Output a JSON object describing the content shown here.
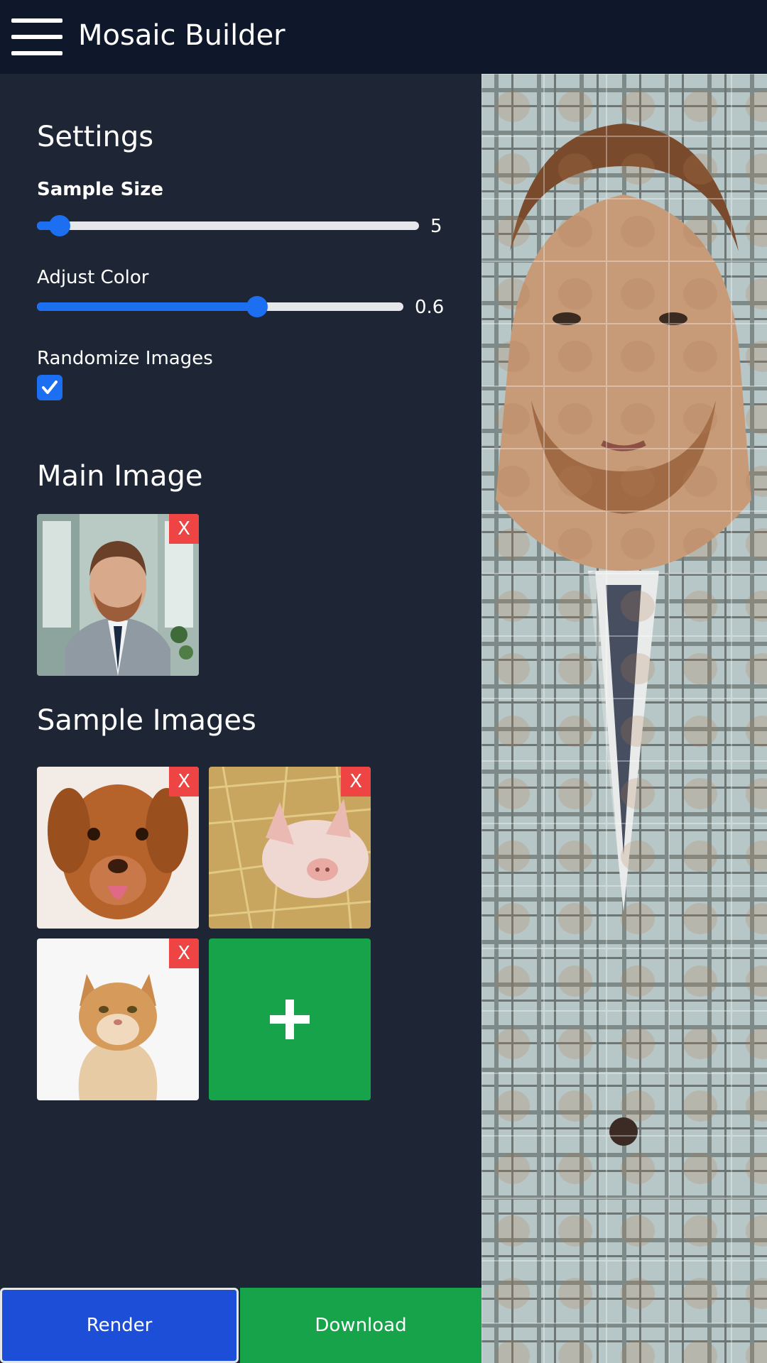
{
  "header": {
    "title": "Mosaic Builder",
    "menu_icon": "hamburger-menu-icon"
  },
  "settings": {
    "heading": "Settings",
    "sample_size": {
      "label": "Sample Size",
      "value": "5",
      "fraction": 0.06
    },
    "adjust_color": {
      "label": "Adjust Color",
      "value": "0.6",
      "fraction": 0.6
    },
    "randomize": {
      "label": "Randomize Images",
      "checked": true
    }
  },
  "main_image": {
    "heading": "Main Image",
    "remove_label": "X"
  },
  "sample_images": {
    "heading": "Sample Images",
    "items": [
      {
        "name": "dog",
        "remove_label": "X"
      },
      {
        "name": "pig",
        "remove_label": "X"
      },
      {
        "name": "cat",
        "remove_label": "X"
      }
    ],
    "add_icon": "plus-icon"
  },
  "actions": {
    "render_label": "Render",
    "download_label": "Download"
  },
  "colors": {
    "accent": "#1d6ff2",
    "render": "#1d4ed8",
    "download": "#16a34a",
    "remove": "#ef4444",
    "sidebar": "#1e2636",
    "header": "#0f172a"
  }
}
